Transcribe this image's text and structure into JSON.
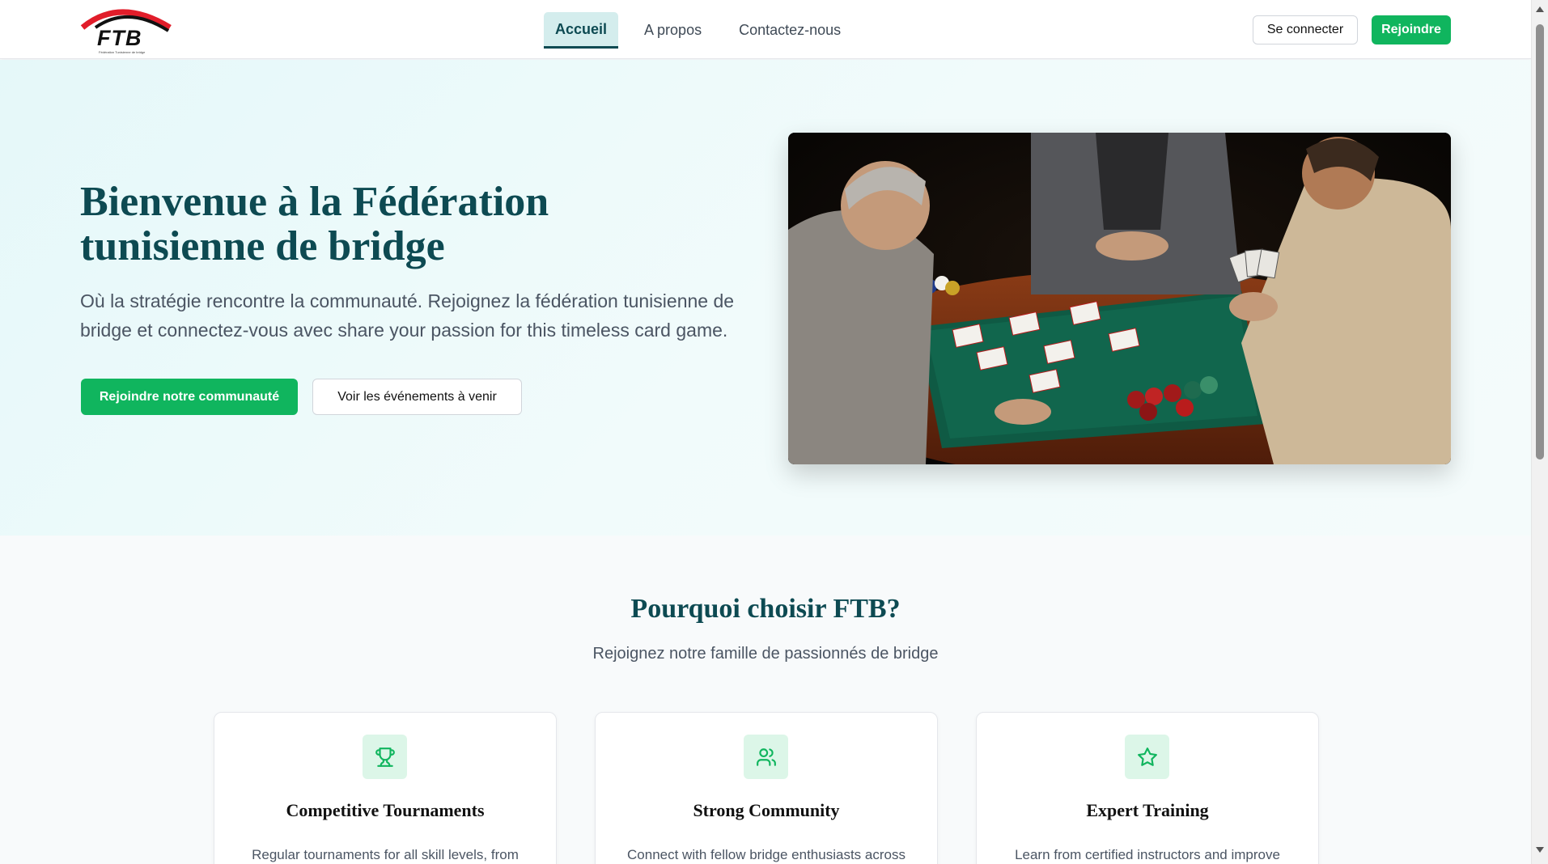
{
  "header": {
    "logo": {
      "text": "FTB",
      "subtitle": "Fédération Tunisienne de bridge"
    },
    "nav": [
      {
        "label": "Accueil",
        "active": true
      },
      {
        "label": "A propos",
        "active": false
      },
      {
        "label": "Contactez-nous",
        "active": false
      }
    ],
    "login_label": "Se connecter",
    "join_label": "Rejoindre"
  },
  "hero": {
    "title": "Bienvenue à la Fédération tunisienne de bridge",
    "subtitle": "Où la stratégie rencontre la communauté. Rejoignez la fédération tunisienne de bridge et connectez-vous avec share your passion for this timeless card game.",
    "primary_button": "Rejoindre notre communauté",
    "secondary_button": "Voir les événements à venir",
    "image_icon": "bridge-players-photo"
  },
  "why": {
    "title": "Pourquoi choisir FTB?",
    "subtitle": "Rejoignez notre famille de passionnés de bridge",
    "cards": [
      {
        "icon": "trophy-icon",
        "title": "Competitive Tournaments",
        "text": "Regular tournaments for all skill levels, from"
      },
      {
        "icon": "users-icon",
        "title": "Strong Community",
        "text": "Connect with fellow bridge enthusiasts across"
      },
      {
        "icon": "star-icon",
        "title": "Expert Training",
        "text": "Learn from certified instructors and improve"
      }
    ]
  },
  "colors": {
    "primary_green": "#10b55e",
    "dark_teal": "#0d4a52",
    "logo_red": "#e11d2a"
  }
}
